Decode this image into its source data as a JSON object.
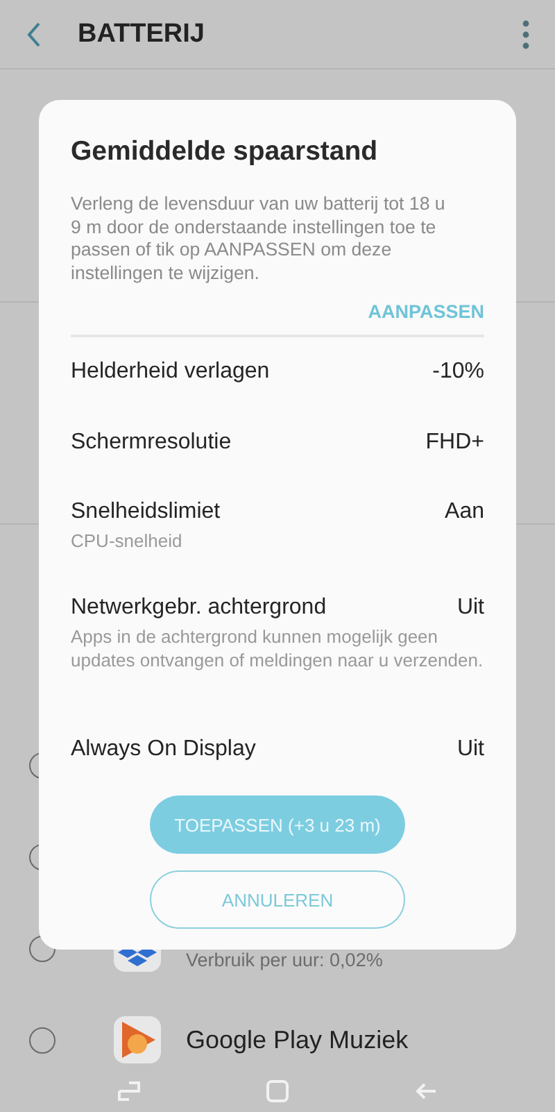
{
  "app_bar": {
    "title": "BATTERIJ"
  },
  "background_apps": [
    {
      "selected": false
    },
    {
      "selected": false
    },
    {
      "selected": false,
      "kind": "boxes",
      "usage": "Verbruik per uur: 0,02%"
    },
    {
      "selected": false,
      "kind": "play",
      "name": "Google Play Muziek"
    }
  ],
  "dialog": {
    "title": "Gemiddelde spaarstand",
    "description": "Verleng de levensduur van uw batterij tot 18 u 9 m door de onderstaande instellingen toe te passen of tik op AANPASSEN om deze instellingen te wijzigen.",
    "action": "AANPASSEN",
    "settings": [
      {
        "label": "Helderheid verlagen",
        "value": "-10%"
      },
      {
        "label": "Schermresolutie",
        "value": "FHD+"
      },
      {
        "label": "Snelheidslimiet",
        "value": "Aan",
        "detail": "CPU-snelheid"
      },
      {
        "label": "Netwerkgebr. achtergrond",
        "value": "Uit",
        "detail": "Apps in de achtergrond kunnen mogelijk geen updates ontvangen of meldingen naar u verzenden."
      },
      {
        "label": "Always On Display",
        "value": "Uit"
      }
    ],
    "buttons": [
      {
        "label": "TOEPASSEN (+3 u 23 m)",
        "kind": "filled"
      },
      {
        "label": "ANNULEREN",
        "kind": "outlined"
      }
    ]
  }
}
